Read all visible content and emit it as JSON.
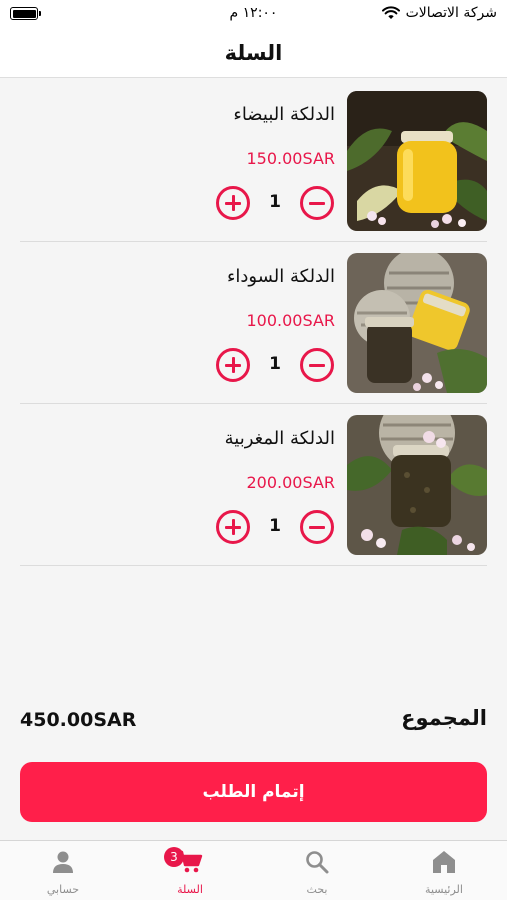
{
  "status_bar": {
    "carrier": "شركة الاتصالات",
    "time": "١٢:٠٠ م"
  },
  "header": {
    "title": "السلة"
  },
  "cart": {
    "items": [
      {
        "name": "الدلكة البيضاء",
        "price": "150.00SAR",
        "quantity": "1",
        "image": "yellow-dalka-jar"
      },
      {
        "name": "الدلكة السوداء",
        "price": "100.00SAR",
        "quantity": "1",
        "image": "black-dalka-jars"
      },
      {
        "name": "الدلكة المغربية",
        "price": "200.00SAR",
        "quantity": "1",
        "image": "moroccan-dalka-jar"
      }
    ],
    "total_label": "المجموع",
    "total_value": "450.00SAR",
    "checkout_label": "إتمام الطلب"
  },
  "tab_bar": {
    "tabs": [
      {
        "label": "الرئيسية",
        "icon": "home-icon"
      },
      {
        "label": "بحث",
        "icon": "search-icon"
      },
      {
        "label": "السلة",
        "icon": "cart-icon",
        "badge": "3",
        "active": true
      },
      {
        "label": "حسابي",
        "icon": "person-icon"
      }
    ]
  },
  "colors": {
    "accent": "#e8174a",
    "checkout_button": "#ff1f4a",
    "inactive_tab": "#8e8e8e"
  }
}
